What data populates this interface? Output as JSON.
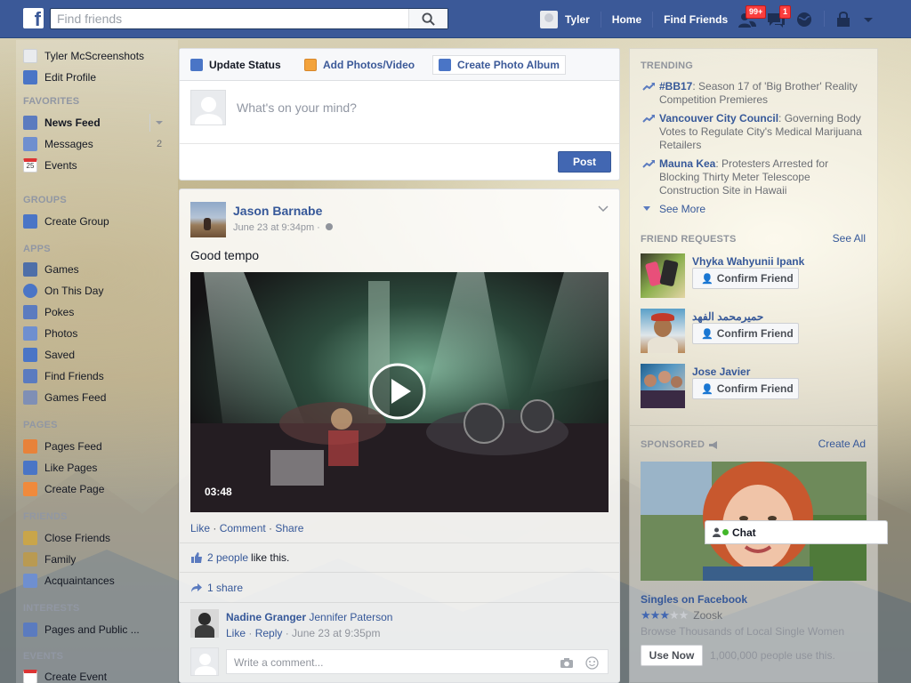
{
  "header": {
    "logo": "f",
    "search_placeholder": "Find friends",
    "user_name": "Tyler",
    "home_label": "Home",
    "find_friends_label": "Find Friends",
    "friend_requests_badge": "99+",
    "messages_badge": "1"
  },
  "sidebar": {
    "profile_name": "Tyler McScreenshots",
    "edit_profile": "Edit Profile",
    "sections": {
      "favorites": "FAVORITES",
      "groups": "GROUPS",
      "apps": "APPS",
      "pages": "PAGES",
      "friends": "FRIENDS",
      "interests": "INTERESTS",
      "events": "EVENTS"
    },
    "favorites": [
      {
        "label": "News Feed"
      },
      {
        "label": "Messages",
        "count": "2"
      },
      {
        "label": "Events"
      }
    ],
    "events_icon_text": "25",
    "groups": [
      {
        "label": "Create Group"
      }
    ],
    "apps": [
      {
        "label": "Games"
      },
      {
        "label": "On This Day"
      },
      {
        "label": "Pokes"
      },
      {
        "label": "Photos"
      },
      {
        "label": "Saved"
      },
      {
        "label": "Find Friends"
      },
      {
        "label": "Games Feed"
      }
    ],
    "pages": [
      {
        "label": "Pages Feed"
      },
      {
        "label": "Like Pages"
      },
      {
        "label": "Create Page"
      }
    ],
    "friends": [
      {
        "label": "Close Friends"
      },
      {
        "label": "Family"
      },
      {
        "label": "Acquaintances"
      }
    ],
    "interests": [
      {
        "label": "Pages and Public ..."
      }
    ],
    "events": [
      {
        "label": "Create Event"
      }
    ]
  },
  "composer": {
    "tabs": [
      "Update Status",
      "Add Photos/Video",
      "Create Photo Album"
    ],
    "placeholder": "What's on your mind?",
    "post_label": "Post"
  },
  "story": {
    "author": "Jason Barnabe",
    "time": "June 23 at 9:34pm ·",
    "text": "Good tempo",
    "video_duration": "03:48",
    "actions": [
      "Like",
      "Comment",
      "Share"
    ],
    "likes_count": "2 people",
    "likes_suffix": "like this.",
    "shares": "1 share",
    "comment": {
      "author": "Nadine Granger",
      "text": "Jennifer Paterson",
      "like": "Like",
      "reply": "Reply",
      "time": "June 23 at 9:35pm"
    },
    "comment_placeholder": "Write a comment..."
  },
  "right": {
    "trending_title": "TRENDING",
    "trending": [
      {
        "topic": "#BB17",
        "desc": ": Season 17 of 'Big Brother' Reality Competition Premieres"
      },
      {
        "topic": "Vancouver City Council",
        "desc": ": Governing Body Votes to Regulate City's Medical Marijuana Retailers"
      },
      {
        "topic": "Mauna Kea",
        "desc": ": Protesters Arrested for Blocking Thirty Meter Telescope Construction Site in Hawaii"
      }
    ],
    "see_more": "See More",
    "friend_requests_title": "FRIEND REQUESTS",
    "see_all": "See All",
    "requests": [
      {
        "name": "Vhyka Wahyunii Ipank"
      },
      {
        "name": "حميرمحمد الفهد"
      },
      {
        "name": "Jose Javier"
      }
    ],
    "confirm_label": "Confirm Friend",
    "sponsored_title": "SPONSORED",
    "create_ad": "Create Ad",
    "ad": {
      "title": "Singles on Facebook",
      "brand": "Zoosk",
      "rating": 3,
      "rating_max": 5,
      "desc": "Browse Thousands of Local Single Women",
      "cta": "Use Now",
      "social": "1,000,000 people use this."
    },
    "chat_label": "Chat"
  }
}
